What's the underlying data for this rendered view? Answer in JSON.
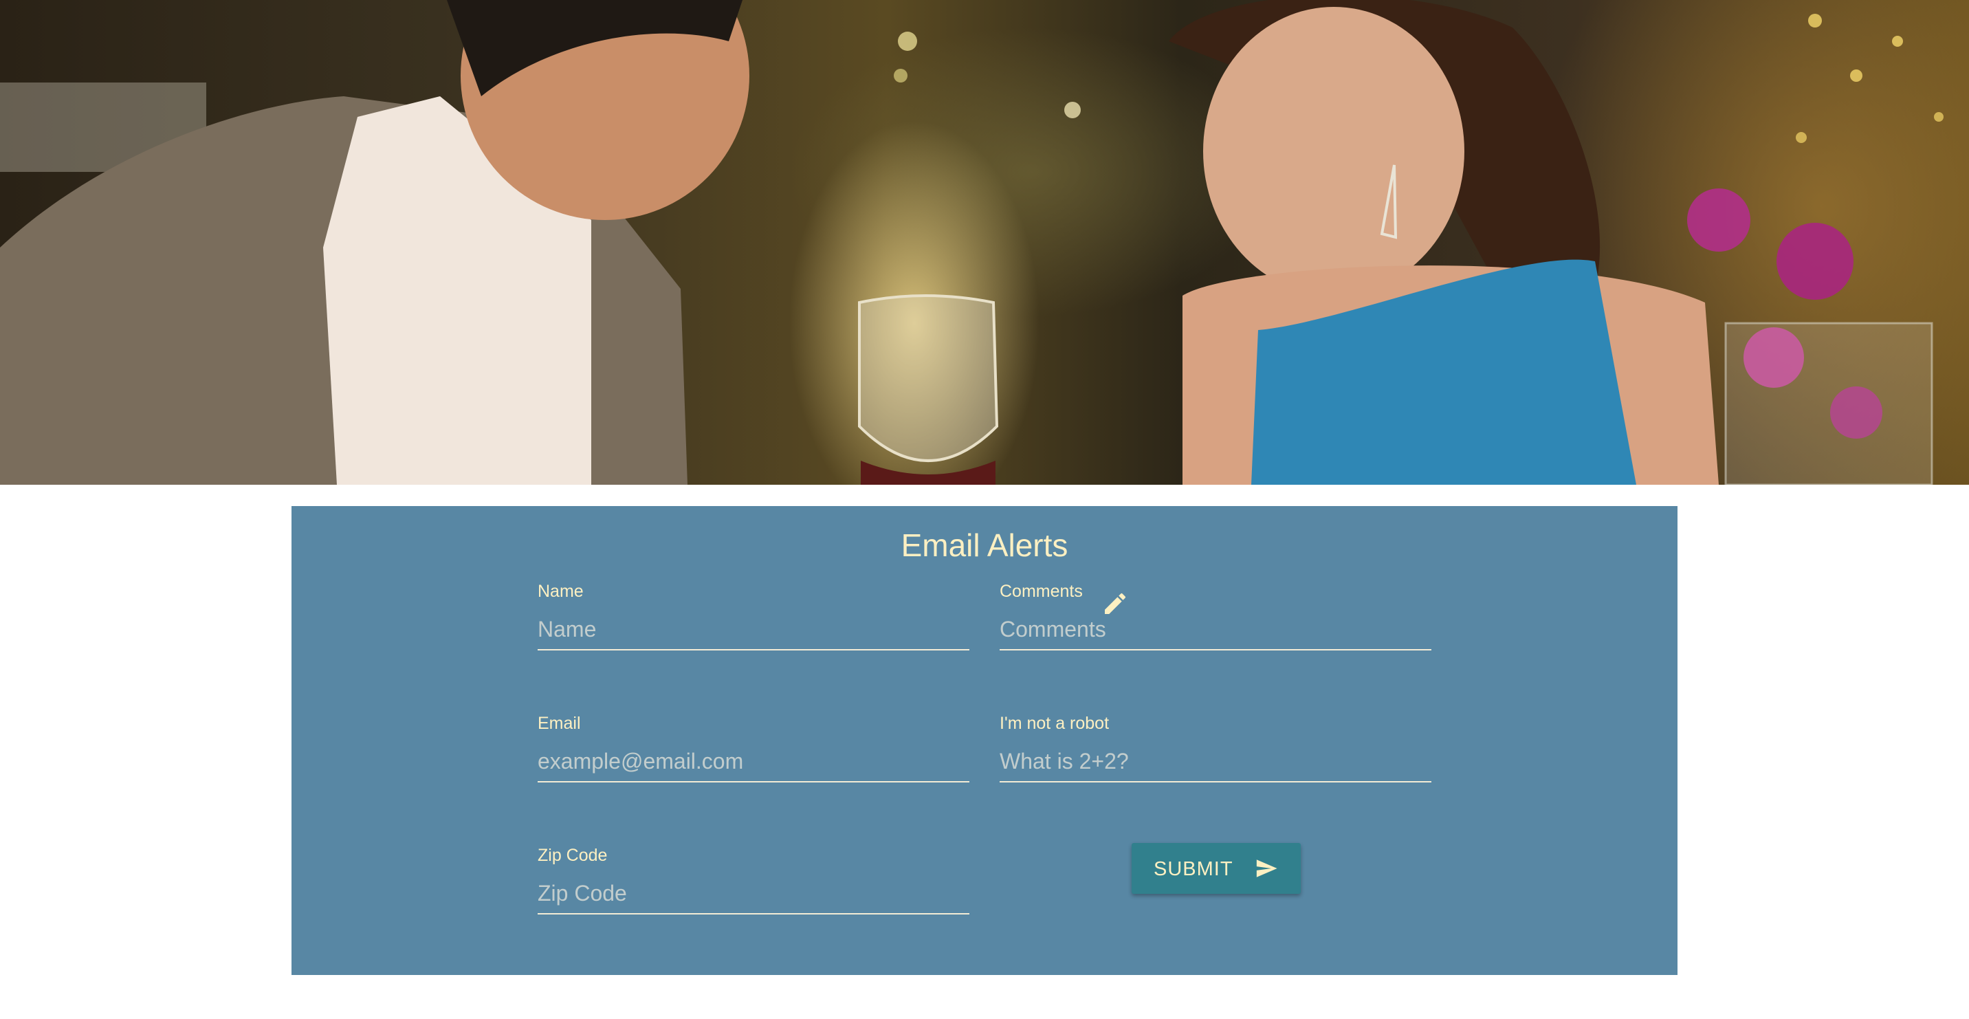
{
  "hero": {
    "image_description": "hero-photo"
  },
  "form": {
    "title": "Email Alerts",
    "fields": {
      "name": {
        "label": "Name",
        "placeholder": "Name"
      },
      "email": {
        "label": "Email",
        "placeholder": "example@email.com"
      },
      "zip": {
        "label": "Zip Code",
        "placeholder": "Zip Code"
      },
      "comments": {
        "label": "Comments",
        "placeholder": "Comments"
      },
      "robot": {
        "label": "I'm not a robot",
        "placeholder": "What is 2+2?"
      }
    },
    "submit_label": "SUBMIT"
  },
  "icons": {
    "comments_icon": "pencil-icon",
    "submit_icon": "send-icon"
  },
  "colors": {
    "panel_background": "#5887a4",
    "text_accent": "#fdf0c2",
    "button_background": "#31808d"
  }
}
